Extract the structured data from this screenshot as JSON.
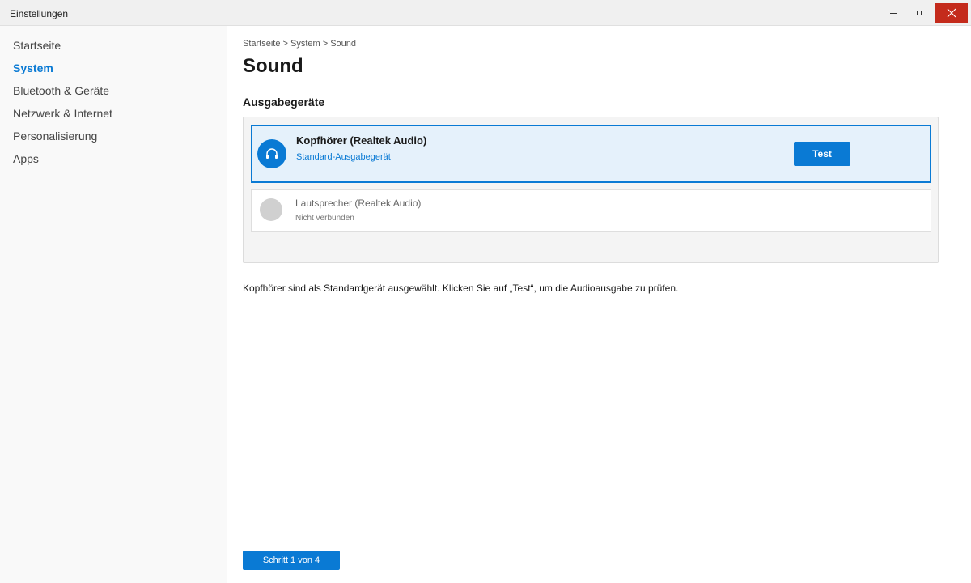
{
  "window": {
    "title": "Einstellungen",
    "controls": {
      "minimize": "minimize-icon",
      "maximize": "maximize-icon",
      "close": "close-icon",
      "close_color": "#c42b1c"
    }
  },
  "sidebar": {
    "items": [
      {
        "label": "Startseite",
        "active": false
      },
      {
        "label": "System",
        "active": true
      },
      {
        "label": "Bluetooth & Geräte",
        "active": false
      },
      {
        "label": "Netzwerk & Internet",
        "active": false
      },
      {
        "label": "Personalisierung",
        "active": false
      },
      {
        "label": "Apps",
        "active": false
      }
    ]
  },
  "main": {
    "breadcrumb": "Startseite > System > Sound",
    "title": "Sound",
    "section_title": "Ausgabegeräte",
    "devices": [
      {
        "name": "Kopfhörer (Realtek Audio)",
        "status": "Standard-Ausgabegerät",
        "selected": true,
        "icon": "headphones-icon",
        "button_label": "Test"
      },
      {
        "name": "Lautsprecher (Realtek Audio)",
        "status": "Nicht verbunden",
        "selected": false,
        "icon": "speaker-icon"
      }
    ],
    "hint": "Kopfhörer sind als Standardgerät ausgewählt. Klicken Sie auf „Test“, um die Audioausgabe zu prüfen.",
    "step_label": "Schritt 1 von 4"
  },
  "colors": {
    "accent": "#0a7ad4",
    "selected_bg": "#e5f1fb"
  }
}
